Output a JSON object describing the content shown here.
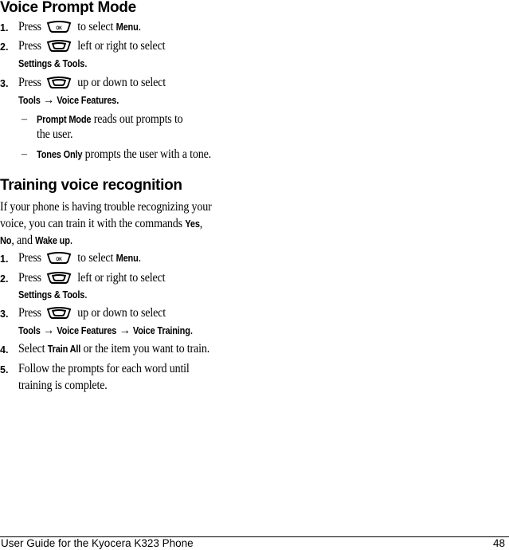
{
  "sections": {
    "voice_prompt": {
      "title": "Voice Prompt Mode",
      "steps": [
        {
          "num": "1.",
          "pre": "Press",
          "icon": "ok-key",
          "post": "to select",
          "bold": "Menu",
          "end": "."
        },
        {
          "num": "2.",
          "pre": "Press",
          "icon": "nav-key",
          "post": "left or right to select",
          "bold2": "Settings & Tools",
          "end2": "."
        },
        {
          "num": "3.",
          "pre": "Press",
          "icon": "nav-key",
          "post": "up or down to select",
          "path_a": "Tools",
          "arrow": "→",
          "path_b": "Voice Features."
        }
      ],
      "options": [
        {
          "dash": "–",
          "bold": "Prompt Mode",
          "text1": "reads out prompts to",
          "text2": "the user."
        },
        {
          "dash": "–",
          "bold": "Tones Only",
          "text1": "prompts the user with a tone."
        }
      ]
    },
    "training": {
      "title": "Training voice recognition",
      "intro": {
        "line1": "If your phone is having trouble recognizing your",
        "line2_pre": "voice, you can train it with the commands",
        "yes": "Yes",
        "comma": ",",
        "no": "No",
        "and": ", and",
        "wake": "Wake up",
        "period": "."
      },
      "steps": [
        {
          "num": "1.",
          "pre": "Press",
          "icon": "ok-key",
          "post": "to select",
          "bold": "Menu",
          "end": "."
        },
        {
          "num": "2.",
          "pre": "Press",
          "icon": "nav-key",
          "post": "left or right to select",
          "bold2": "Settings & Tools",
          "end2": "."
        },
        {
          "num": "3.",
          "pre": "Press",
          "icon": "nav-key",
          "post": "up or down to select",
          "path_a": "Tools",
          "arrow": "→",
          "path_b": "Voice Features",
          "arrow2": "→",
          "path_c": "Voice Training",
          "end2": "."
        },
        {
          "num": "4.",
          "pre": "Select",
          "bold": "Train All",
          "post": "or the item you want to train."
        },
        {
          "num": "5.",
          "line1": "Follow the prompts for each word until",
          "line2": "training is complete."
        }
      ]
    }
  },
  "footer": {
    "title": "User Guide for the Kyocera K323 Phone",
    "page": "48"
  }
}
